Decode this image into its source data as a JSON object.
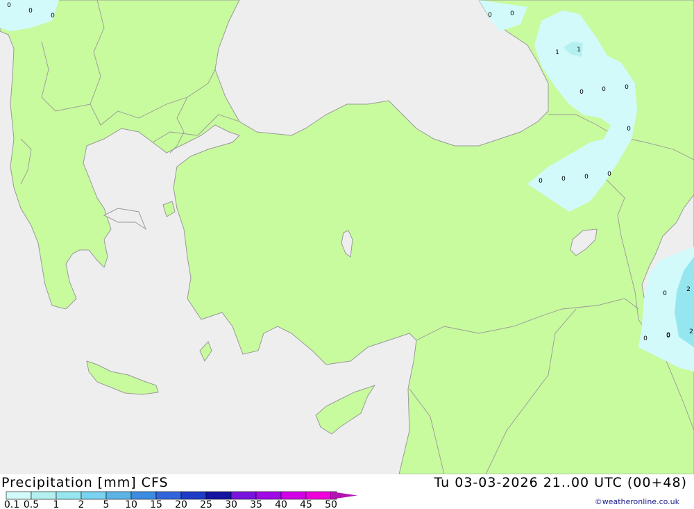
{
  "header": {
    "title": "Precipitation [mm] CFS",
    "datetime": "Tu 03-03-2026 21..00 UTC (00+48)",
    "credit": "©weatheronline.co.uk"
  },
  "colors": {
    "sea": "#eeeeee",
    "land": "#c8fa9e",
    "border": "#999999"
  },
  "legend": {
    "labels": [
      "0.1",
      "0.5",
      "1",
      "2",
      "5",
      "10",
      "15",
      "20",
      "25",
      "30",
      "35",
      "40",
      "45",
      "50"
    ],
    "colors": [
      "#d2fafa",
      "#b4f0f0",
      "#96e6f0",
      "#78d2f0",
      "#5ab4e6",
      "#3c8ce1",
      "#3264dc",
      "#1e3cc8",
      "#1414a0",
      "#7814dc",
      "#a00ae6",
      "#d200e6",
      "#f000dc",
      "#b414b4"
    ]
  },
  "map_values": [
    "0",
    "0",
    "0",
    "0",
    "0",
    "1",
    "1",
    "0",
    "0",
    "0",
    "0",
    "0",
    "0",
    "0",
    "0",
    "0",
    "0",
    "2",
    "0",
    "0",
    "2"
  ]
}
